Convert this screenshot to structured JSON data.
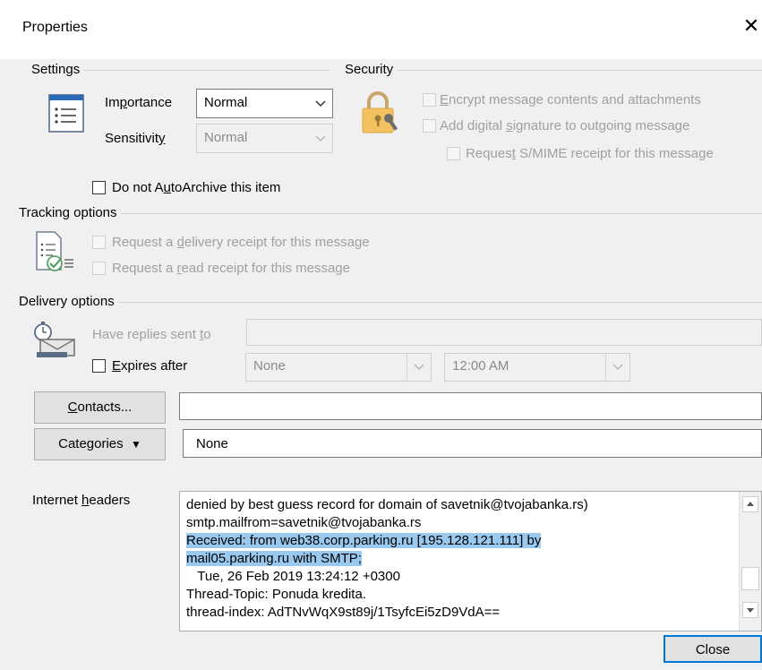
{
  "window": {
    "title": "Properties",
    "close_glyph": "✕"
  },
  "settings": {
    "group_label": "Settings",
    "importance_label_pre": "Im",
    "importance_label_u": "p",
    "importance_label_post": "ortance",
    "importance_value": "Normal",
    "sensitivity_label_pre": "Sensitivit",
    "sensitivity_label_u": "y",
    "sensitivity_label_post": "",
    "sensitivity_value": "Normal",
    "autoarchive_pre": "Do not A",
    "autoarchive_u": "u",
    "autoarchive_post": "toArchive this item",
    "icon": "message-settings-icon"
  },
  "security": {
    "group_label": "Security",
    "icon": "lock-key-icon",
    "encrypt_u": "E",
    "encrypt_post": "ncrypt message contents and attachments",
    "signature_pre": "Add digital ",
    "signature_u": "s",
    "signature_post": "ignature to outgoing message",
    "smime_pre": "Reques",
    "smime_u": "t",
    "smime_post": " S/MIME receipt for this message"
  },
  "tracking": {
    "group_label": "Tracking options",
    "icon": "tracking-checklist-icon",
    "delivery_pre": "Request a ",
    "delivery_u": "d",
    "delivery_post": "elivery receipt for this message",
    "read_pre": "Request a ",
    "read_u": "r",
    "read_post": "ead receipt for this message"
  },
  "delivery": {
    "group_label": "Delivery options",
    "icon": "timer-envelope-icon",
    "replies_pre": "Have replies sent ",
    "replies_u": "t",
    "replies_post": "o",
    "replies_value": "",
    "expires_u": "E",
    "expires_post": "xpires after",
    "expires_date": "None",
    "expires_time": "12:00 AM"
  },
  "contacts": {
    "button_u": "C",
    "button_post": "ontacts...",
    "value": ""
  },
  "categories": {
    "button_pre": "Cate",
    "button_u": "g",
    "button_post": "ories",
    "arrow": "▼",
    "value": "None"
  },
  "headers": {
    "label_pre": "Internet ",
    "label_u": "h",
    "label_post": "eaders",
    "lines": [
      "denied by best guess record for domain of savetnik@tvojabanka.rs)",
      "smtp.mailfrom=savetnik@tvojabanka.rs",
      "Received: from web38.corp.parking.ru [195.128.121.111] by",
      "mail05.parking.ru with SMTP;",
      "   Tue, 26 Feb 2019 13:24:12 +0300",
      "Thread-Topic: Ponuda kredita.",
      "thread-index: AdTNvWqX9st89j/1TsyfcEi5zD9VdA=="
    ]
  },
  "footer": {
    "close_label": "Close"
  }
}
